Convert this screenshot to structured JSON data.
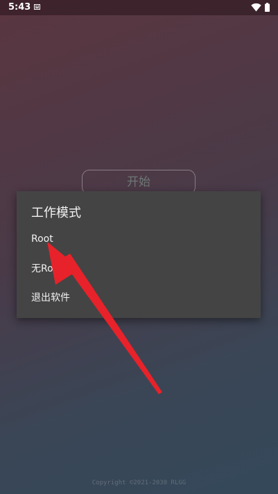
{
  "status_bar": {
    "time": "5:43",
    "notification_icon": "notification-icon",
    "wifi_icon": "wifi-icon",
    "battery_icon": "battery-icon"
  },
  "main": {
    "start_button_label": "开始"
  },
  "dialog": {
    "title": "工作模式",
    "items": [
      {
        "label": "Root"
      },
      {
        "label": "无Root"
      },
      {
        "label": "退出软件"
      }
    ]
  },
  "annotation": {
    "arrow_color": "#e8222a"
  },
  "footer": {
    "copyright": "Copyright ©2021-2030 RLGG"
  },
  "colors": {
    "dialog_bg": "#444444",
    "dialog_text": "#f2f2f2"
  }
}
